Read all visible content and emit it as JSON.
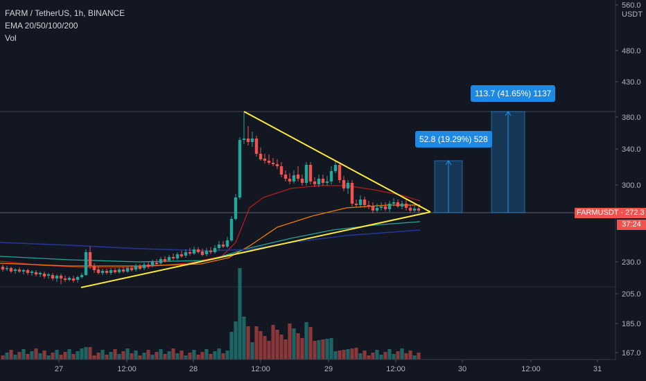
{
  "header": {
    "symbol": "FARM / TetherUS, 1h, BINANCE",
    "ema": "EMA 20/50/100/200",
    "vol": "Vol"
  },
  "price_axis": {
    "currency": "USDT",
    "ticks": [
      "560.0",
      "480.0",
      "430.0",
      "380.0",
      "340.0",
      "300.0",
      "230.0",
      "205.0",
      "185.0",
      "167.0"
    ]
  },
  "time_axis": {
    "ticks": [
      "27",
      "12:00",
      "28",
      "12:00",
      "29",
      "12:00",
      "30",
      "12:00",
      "31"
    ]
  },
  "last_price": {
    "symbol": "FARMUSDT",
    "value": "272.3",
    "countdown": "37:24"
  },
  "measures": [
    {
      "label": "52.8 (19.29%) 528"
    },
    {
      "label": "113.7 (41.65%) 1137"
    }
  ],
  "colors": {
    "background": "#131722",
    "up": "#26a69a",
    "down": "#ef5350",
    "triangle": "#ffeb3b",
    "measure": "#1e88e5"
  },
  "chart_data": {
    "type": "candlestick",
    "y_scale": "log",
    "price_range": [
      167,
      560
    ],
    "ema_periods": [
      20,
      50,
      100,
      200
    ],
    "projections": [
      52.8,
      113.7
    ]
  }
}
